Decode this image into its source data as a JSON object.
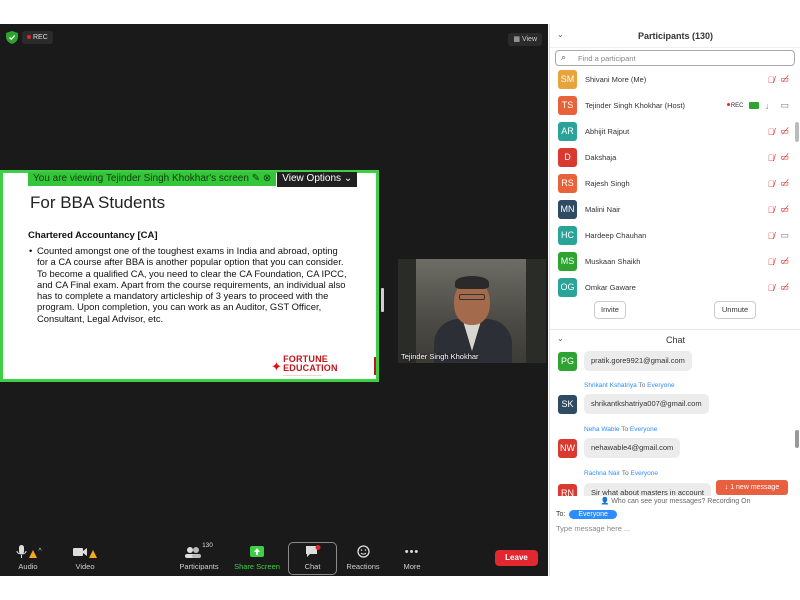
{
  "meeting": {
    "rec_label": "REC",
    "view_label": "View",
    "share_banner": "You are viewing Tejinder Singh Khokhar's screen",
    "view_options": "View Options",
    "slide": {
      "title": "For BBA Students",
      "subtitle": "Chartered Accountancy [CA]",
      "bullet": "•",
      "body": "Counted amongst one of the toughest exams in India and abroad, opting for a CA course after BBA is another popular option that you can consider. To become a qualified CA, you need to clear the CA Foundation, CA IPCC, and CA Final exam. Apart from the course requirements, an individual also has to complete a mandatory articleship of 3 years to proceed with the program. Upon completion, you can work as an Auditor, GST Officer, Consultant, Legal Advisor, etc.",
      "logo_text": "FORTUNE EDUCATION"
    },
    "video_name": "Tejinder Singh Khokhar"
  },
  "toolbar": {
    "audio": "Audio",
    "video": "Video",
    "participants": "Participants",
    "participants_count": "130",
    "share_screen": "Share Screen",
    "chat": "Chat",
    "reactions": "Reactions",
    "more": "More",
    "leave": "Leave"
  },
  "participants_panel": {
    "title": "Participants (130)",
    "search_placeholder": "Find a participant",
    "items": [
      {
        "initials": "SM",
        "name": "Shivani More (Me)",
        "color": "#e8a33a"
      },
      {
        "initials": "TS",
        "name": "Tejinder Singh Khokhar (Host)",
        "color": "#e8633a",
        "rec": "REC"
      },
      {
        "initials": "AR",
        "name": "Abhijit Rajput",
        "color": "#2aa39a"
      },
      {
        "initials": "D",
        "name": "Dakshaja",
        "color": "#d83a30"
      },
      {
        "initials": "RS",
        "name": "Rajesh Singh",
        "color": "#e8633a"
      },
      {
        "initials": "MN",
        "name": "Malini Nair",
        "color": "#2f4a63"
      },
      {
        "initials": "HC",
        "name": "Hardeep Chauhan",
        "color": "#2aa39a"
      },
      {
        "initials": "MS",
        "name": "Muskaan Shaikh",
        "color": "#2ea331"
      },
      {
        "initials": "OG",
        "name": "Omkar Gaware",
        "color": "#2aa39a"
      }
    ],
    "invite": "Invite",
    "unmute": "Unmute"
  },
  "chat": {
    "title": "Chat",
    "messages": [
      {
        "initials": "PG",
        "color": "#2ea331",
        "text": "pratik.gore9921@gmail.com"
      },
      {
        "initials": "SK",
        "color": "#2f4a63",
        "from": "Shrikant Kshatriya",
        "to": "To",
        "everyone": "Everyone",
        "text": "shrikantkshatriya007@gmail.com"
      },
      {
        "initials": "NW",
        "color": "#d83a30",
        "from": "Neha Wable",
        "to": "To",
        "everyone": "Everyone",
        "text": "nehawable4@gmail.com"
      },
      {
        "initials": "RN",
        "color": "#d83a30",
        "from": "Rachna Nair",
        "to": "To",
        "everyone": "Everyone",
        "text": "Sir what about masters in account"
      }
    ],
    "new_message": "↓ 1 new message",
    "who_can_see": "Who can see your messages? Recording On",
    "to_label": "To:",
    "to_value": "Everyone",
    "input_placeholder": "Type message here ..."
  }
}
